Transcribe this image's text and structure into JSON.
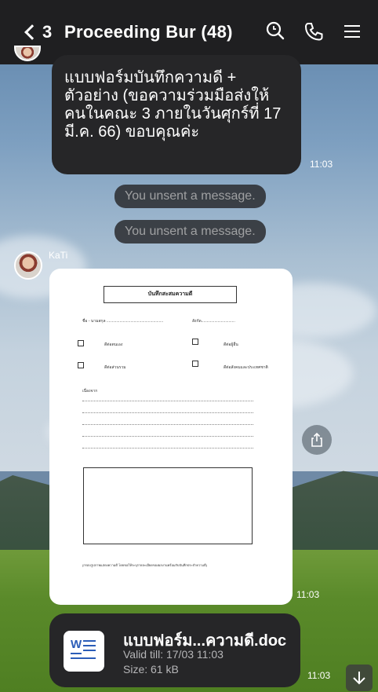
{
  "header": {
    "back_count": "3",
    "title": "Proceeding Bur (48)",
    "icons": [
      "back-chevron-icon",
      "search-icon",
      "phone-icon",
      "menu-icon"
    ]
  },
  "messages": {
    "msg1_text": "แบบฟอร์มบันทึกความดี + ตัวอย่าง (ขอความร่วมมือส่งให้คนในคณะ 3 ภายในวันศุกร์ที่ 17 มี.ค. 66) ขอบคุณค่ะ",
    "msg1_time": "11:03",
    "unsent1": "You unsent a message.",
    "unsent2": "You unsent a message.",
    "sender": "KaTi",
    "doc_time": "11:03",
    "file_time": "11:03"
  },
  "doc_preview": {
    "title": "บันทึกสะสมความดี",
    "name_line": "ชื่อ - นามสกุล ....................................................",
    "faculty_line": "สังกัด...............................",
    "options": [
      "ดีต่อตนเอง",
      "ดีต่อผู้อื่น",
      "ดีต่อส่วนรวม",
      "ดีต่อสังคมและประเทศชาติ"
    ],
    "reason_label": "เนื่องจาก",
    "footnote": "(กรอบรูปภาพแสดงความดี โดยขอให้ระบุรายละเอียดของผลงานพร้อมกับบันทึกประจำความดี)"
  },
  "file": {
    "name": "แบบฟอร์ม...ความดี.doc",
    "valid": "Valid till: 17/03 11:03",
    "size": "Size: 61 kB",
    "icon_label": "W"
  },
  "colors": {
    "bubble": "#262628",
    "header": "#1f1f21",
    "word_blue": "#2b5db8"
  }
}
